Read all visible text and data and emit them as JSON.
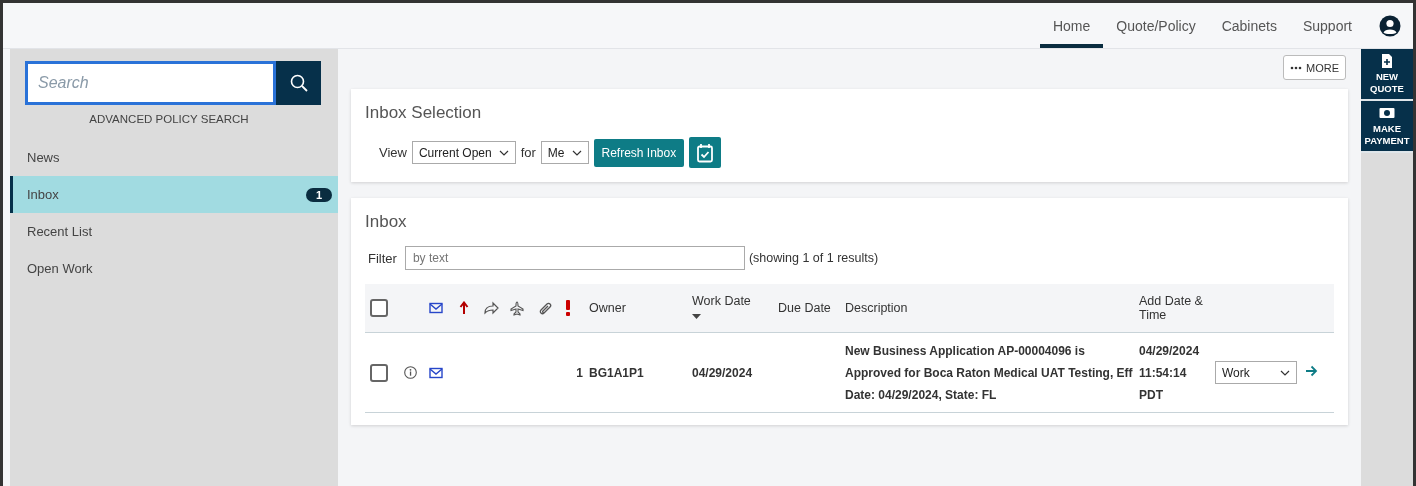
{
  "top_nav": {
    "tabs": [
      {
        "label": "Home",
        "selected": true
      },
      {
        "label": "Quote/Policy",
        "selected": false
      },
      {
        "label": "Cabinets",
        "selected": false
      },
      {
        "label": "Support",
        "selected": false
      }
    ]
  },
  "sidebar": {
    "search": {
      "placeholder": "Search"
    },
    "advanced_link": "ADVANCED POLICY SEARCH",
    "items": [
      {
        "label": "News",
        "selected": false
      },
      {
        "label": "Inbox",
        "selected": true,
        "badge": "1"
      },
      {
        "label": "Recent List",
        "selected": false
      },
      {
        "label": "Open Work",
        "selected": false
      }
    ]
  },
  "more_button": "MORE",
  "right_rail": [
    {
      "kind": "new-quote",
      "label": "NEW QUOTE"
    },
    {
      "kind": "payment",
      "label": "MAKE PAYMENT"
    }
  ],
  "inbox_selection": {
    "title": "Inbox Selection",
    "view_label": "View",
    "view_value": "Current Open",
    "for_label": "for",
    "for_value": "Me",
    "refresh_button": "Refresh Inbox"
  },
  "inbox": {
    "title": "Inbox",
    "filter_label": "Filter",
    "filter_placeholder": "by text",
    "result_count": "(showing 1 of 1 results)",
    "table": {
      "select_all_checked": false,
      "columns": [
        {
          "kind": "blank"
        },
        {
          "kind": "mail"
        },
        {
          "kind": "priority"
        },
        {
          "kind": "forward"
        },
        {
          "kind": "plane"
        },
        {
          "kind": "attachment"
        },
        {
          "kind": "urgent"
        },
        {
          "kind": "text",
          "label": "Owner"
        },
        {
          "kind": "text",
          "label": "Work Date",
          "sorted": true
        },
        {
          "kind": "text",
          "label": "Due Date"
        },
        {
          "kind": "text",
          "label": "Description"
        },
        {
          "kind": "text",
          "label": "Add Date & Time"
        }
      ],
      "rows": [
        {
          "checked": false,
          "info": true,
          "mail": true,
          "urgent_count": "1",
          "owner": "BG1A1P1",
          "work_date": "04/29/2024",
          "description": "New Business Application AP-00004096 is Approved for Boca Raton Medical UAT Testing, Eff Date: 04/29/2024, State: FL",
          "add_date": "04/29/2024 11:54:14 PDT",
          "action": "Work"
        }
      ]
    }
  }
}
